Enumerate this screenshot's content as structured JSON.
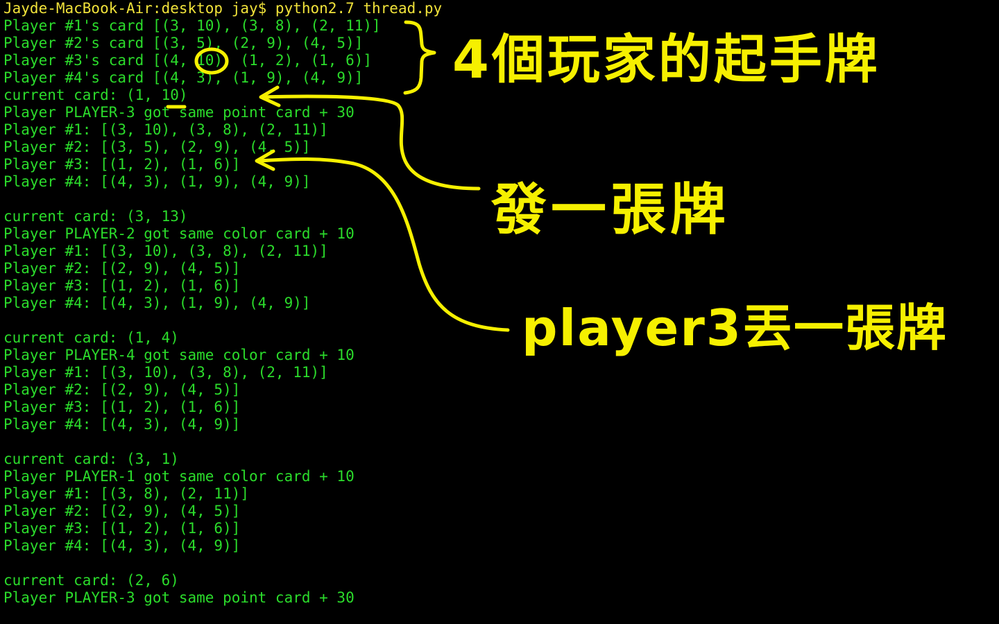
{
  "terminal": {
    "colors": {
      "background": "#000000",
      "output_text": "#2bdc2b",
      "prompt_text": "#f0e23a",
      "annotation_ink": "#f6f000"
    },
    "lines": [
      "Jayde-MacBook-Air:desktop jay$ python2.7 thread.py",
      "Player #1's card [(3, 10), (3, 8), (2, 11)]",
      "Player #2's card [(3, 5), (2, 9), (4, 5)]",
      "Player #3's card [(4, 10), (1, 2), (1, 6)]",
      "Player #4's card [(4, 3), (1, 9), (4, 9)]",
      "current card: (1, 10)",
      "Player PLAYER-3 got same point card + 30",
      "Player #1: [(3, 10), (3, 8), (2, 11)]",
      "Player #2: [(3, 5), (2, 9), (4, 5)]",
      "Player #3: [(1, 2), (1, 6)]",
      "Player #4: [(4, 3), (1, 9), (4, 9)]",
      "",
      "current card: (3, 13)",
      "Player PLAYER-2 got same color card + 10",
      "Player #1: [(3, 10), (3, 8), (2, 11)]",
      "Player #2: [(2, 9), (4, 5)]",
      "Player #3: [(1, 2), (1, 6)]",
      "Player #4: [(4, 3), (1, 9), (4, 9)]",
      "",
      "current card: (1, 4)",
      "Player PLAYER-4 got same color card + 10",
      "Player #1: [(3, 10), (3, 8), (2, 11)]",
      "Player #2: [(2, 9), (4, 5)]",
      "Player #3: [(1, 2), (1, 6)]",
      "Player #4: [(4, 3), (4, 9)]",
      "",
      "current card: (3, 1)",
      "Player PLAYER-1 got same color card + 10",
      "Player #1: [(3, 8), (2, 11)]",
      "Player #2: [(2, 9), (4, 5)]",
      "Player #3: [(1, 2), (1, 6)]",
      "Player #4: [(4, 3), (4, 9)]",
      "",
      "current card: (2, 6)",
      "Player PLAYER-3 got same point card + 30"
    ]
  },
  "annotations": {
    "starting_hands_note": "4個玩家的起手牌",
    "deal_card_note": "發一張牌",
    "player3_discard_note": "player3丟一張牌"
  }
}
